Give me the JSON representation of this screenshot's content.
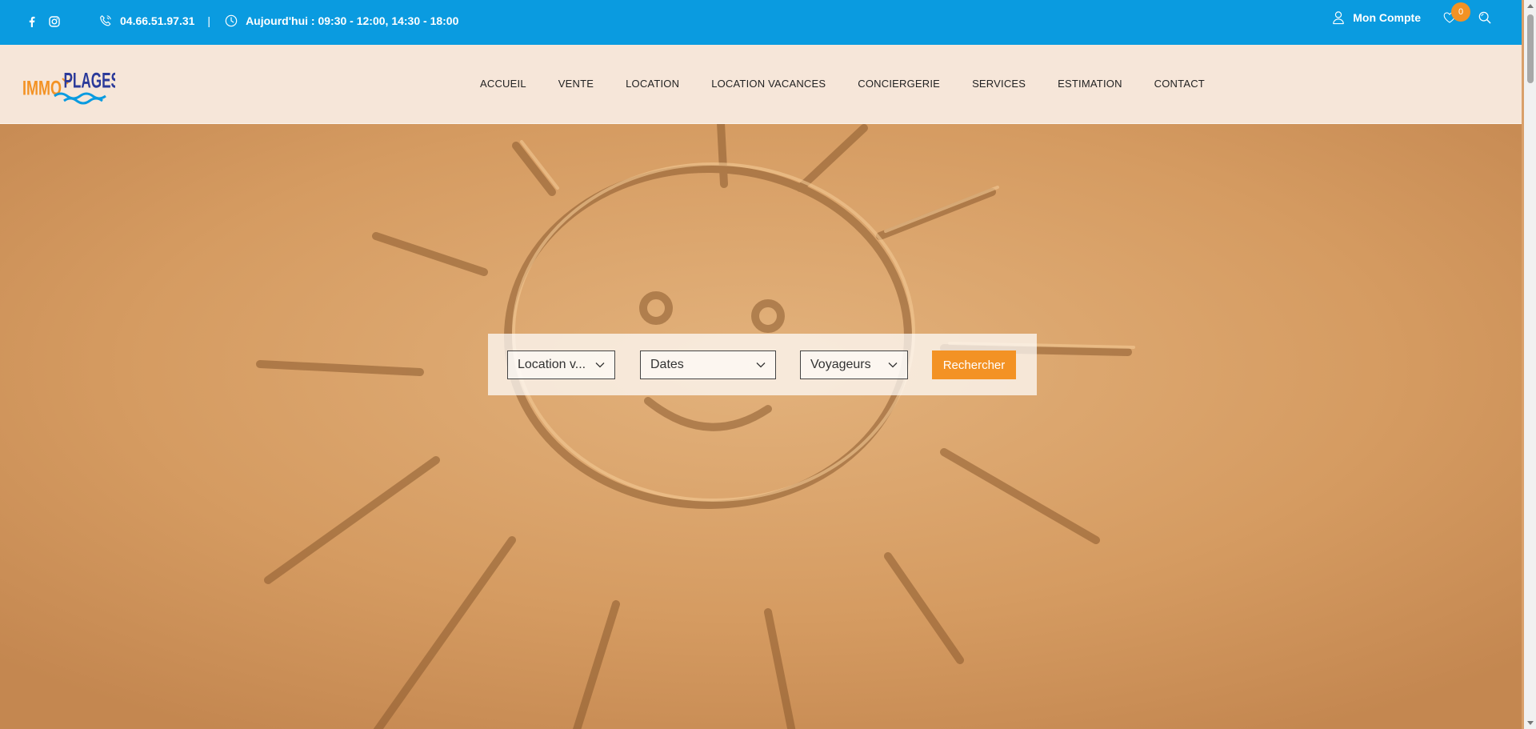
{
  "topbar": {
    "phone": "04.66.51.97.31",
    "separator": "|",
    "hours": "Aujourd'hui : 09:30 - 12:00, 14:30 - 18:00",
    "account_label": "Mon Compte",
    "favorites_count": "0"
  },
  "logo": {
    "text_left": "IMMO",
    "text_right": "PLAGES"
  },
  "nav": {
    "items": [
      "ACCUEIL",
      "VENTE",
      "LOCATION",
      "LOCATION VACANCES",
      "CONCIERGERIE",
      "SERVICES",
      "ESTIMATION",
      "CONTACT"
    ]
  },
  "search": {
    "type_label": "Location v...",
    "dates_label": "Dates",
    "guests_label": "Voyageurs",
    "submit_label": "Rechercher"
  },
  "colors": {
    "topbar": "#0a9be0",
    "accent": "#f39224",
    "sand": "#d9a06a"
  },
  "icons": {
    "social": [
      "facebook-icon",
      "instagram-icon"
    ],
    "phone": "phone-icon",
    "clock": "clock-icon",
    "account": "user-icon",
    "favorites": "heart-icon",
    "search": "search-icon"
  }
}
